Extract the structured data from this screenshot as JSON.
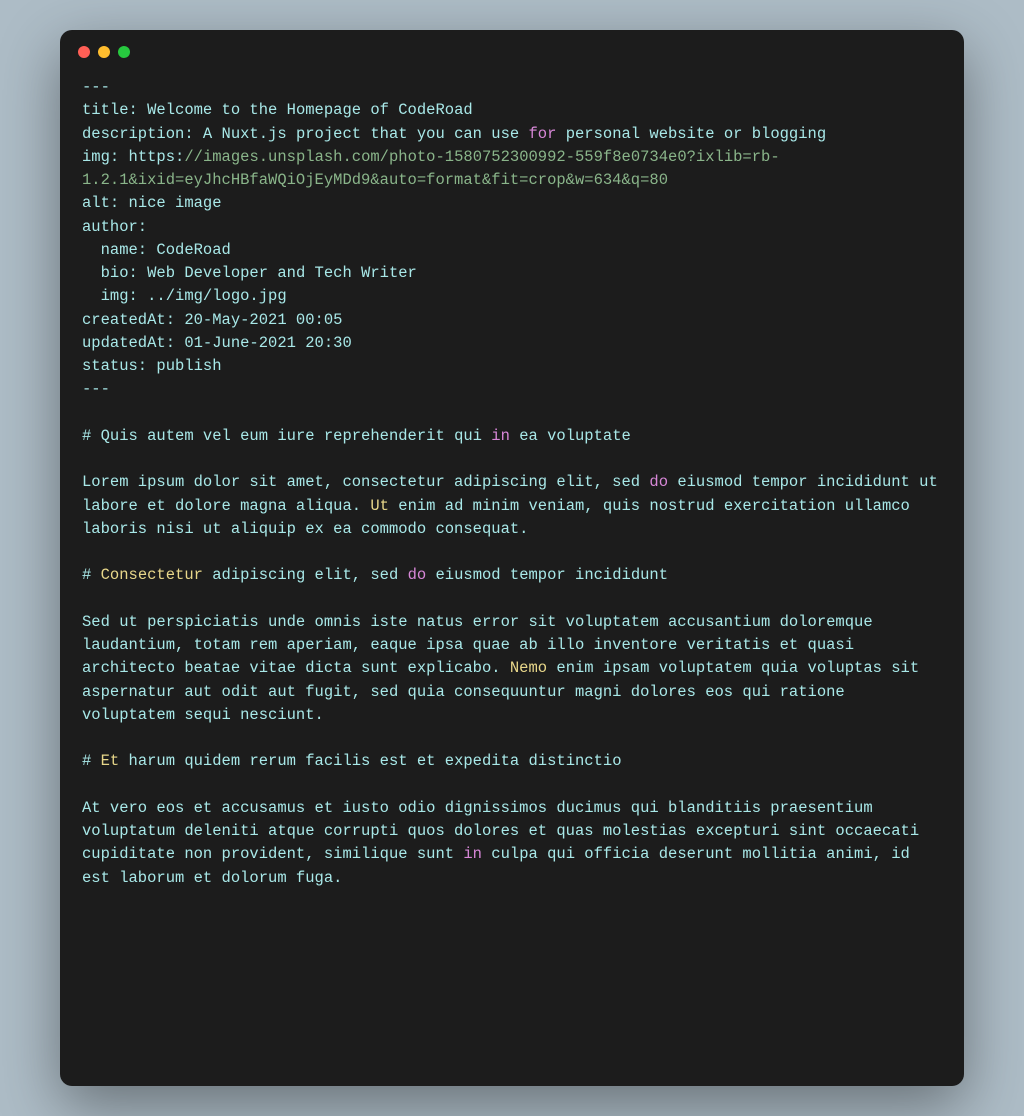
{
  "frontmatter": {
    "delimiter": "---",
    "title_key": "title:",
    "title_value": " Welcome to the Homepage of CodeRoad",
    "description_key": "description:",
    "description_value_pre": " A Nuxt.js project that you can use ",
    "description_for": "for",
    "description_value_post": " personal website or blogging",
    "img_key": "img:",
    "img_scheme": " https:",
    "img_url": "//images.unsplash.com/photo-1580752300992-559f8e0734e0?ixlib=rb-1.2.1&ixid=eyJhcHBfaWQiOjEyMDd9&auto=format&fit=crop&w=634&q=80",
    "alt_key": "alt:",
    "alt_value": " nice image",
    "author_key": "author:",
    "author_name_key": "name:",
    "author_name_value": " CodeRoad",
    "author_bio_key": "bio:",
    "author_bio_value": " Web Developer and Tech Writer",
    "author_img_key": "img:",
    "author_img_value": " ../img/logo.jpg",
    "createdAt_key": "createdAt:",
    "createdAt_value": " 20-May-2021 00:05",
    "updatedAt_key": "updatedAt:",
    "updatedAt_value": " 01-June-2021 20:30",
    "status_key": "status:",
    "status_value": " publish"
  },
  "sections": {
    "h1_hash": "# ",
    "h1_pre": "Quis autem vel eum iure reprehenderit qui ",
    "h1_in": "in",
    "h1_post": " ea voluptate",
    "p1_pre": "Lorem ipsum dolor sit amet, consectetur adipiscing elit, sed ",
    "p1_do": "do",
    "p1_mid": " eiusmod tempor incididunt ut labore et dolore magna aliqua. ",
    "p1_ut": "Ut",
    "p1_post": " enim ad minim veniam, quis nostrud exercitation ullamco laboris nisi ut aliquip ex ea commodo consequat.",
    "h2_hash": "# ",
    "h2_con": "Consectetur",
    "h2_mid": " adipiscing elit, sed ",
    "h2_do": "do",
    "h2_post": " eiusmod tempor incididunt",
    "p2_pre": "Sed ut perspiciatis unde omnis iste natus error sit voluptatem accusantium doloremque laudantium, totam rem aperiam, eaque ipsa quae ab illo inventore veritatis et quasi architecto beatae vitae dicta sunt explicabo. ",
    "p2_nemo": "Nemo",
    "p2_post": " enim ipsam voluptatem quia voluptas sit aspernatur aut odit aut fugit, sed quia consequuntur magni dolores eos qui ratione voluptatem sequi nesciunt.",
    "h3_hash": "# ",
    "h3_et": "Et",
    "h3_post": " harum quidem rerum facilis est et expedita distinctio",
    "p3_pre": "At vero eos et accusamus et iusto odio dignissimos ducimus qui blanditiis praesentium voluptatum deleniti atque corrupti quos dolores et quas molestias excepturi sint occaecati cupiditate non provident, similique sunt ",
    "p3_in": "in",
    "p3_post": " culpa qui officia deserunt mollitia animi, id est laborum et dolorum fuga."
  }
}
